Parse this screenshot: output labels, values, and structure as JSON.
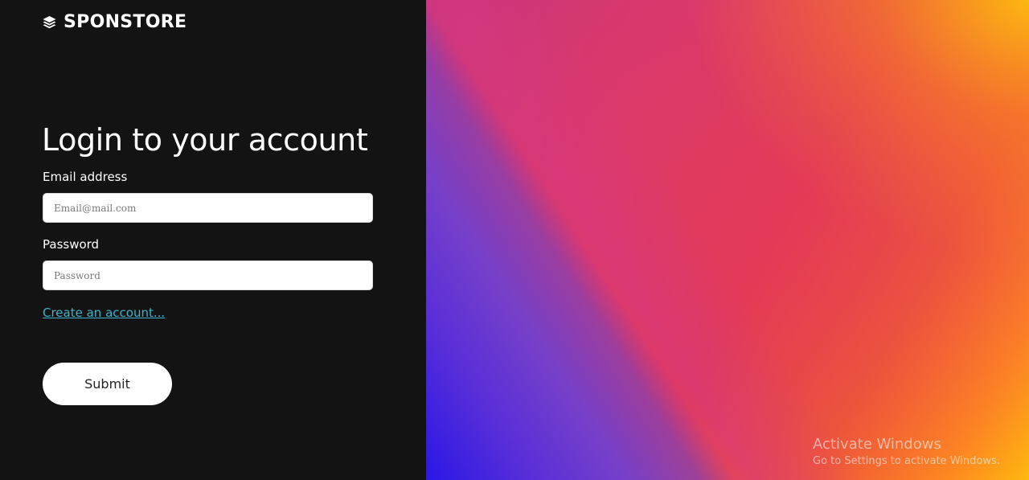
{
  "brand": {
    "name": "SPONSTORE",
    "icon": "layers-icon"
  },
  "login": {
    "title": "Login to your account",
    "email_label": "Email address",
    "email_placeholder": "Email@mail.com",
    "email_value": "",
    "password_label": "Password",
    "password_placeholder": "Password",
    "password_value": "",
    "create_account_link": "Create an account...",
    "submit_label": "Submit"
  },
  "watermark": {
    "title": "Activate Windows",
    "subtitle": "Go to Settings to activate Windows."
  },
  "colors": {
    "left_background": "#131313",
    "link": "#3fb3c9",
    "button_background": "#ffffff",
    "gradient_purple": "#2a17e6",
    "gradient_pink": "#d83a72",
    "gradient_orange": "#ff8a1e",
    "gradient_yellow": "#ffc40a"
  }
}
